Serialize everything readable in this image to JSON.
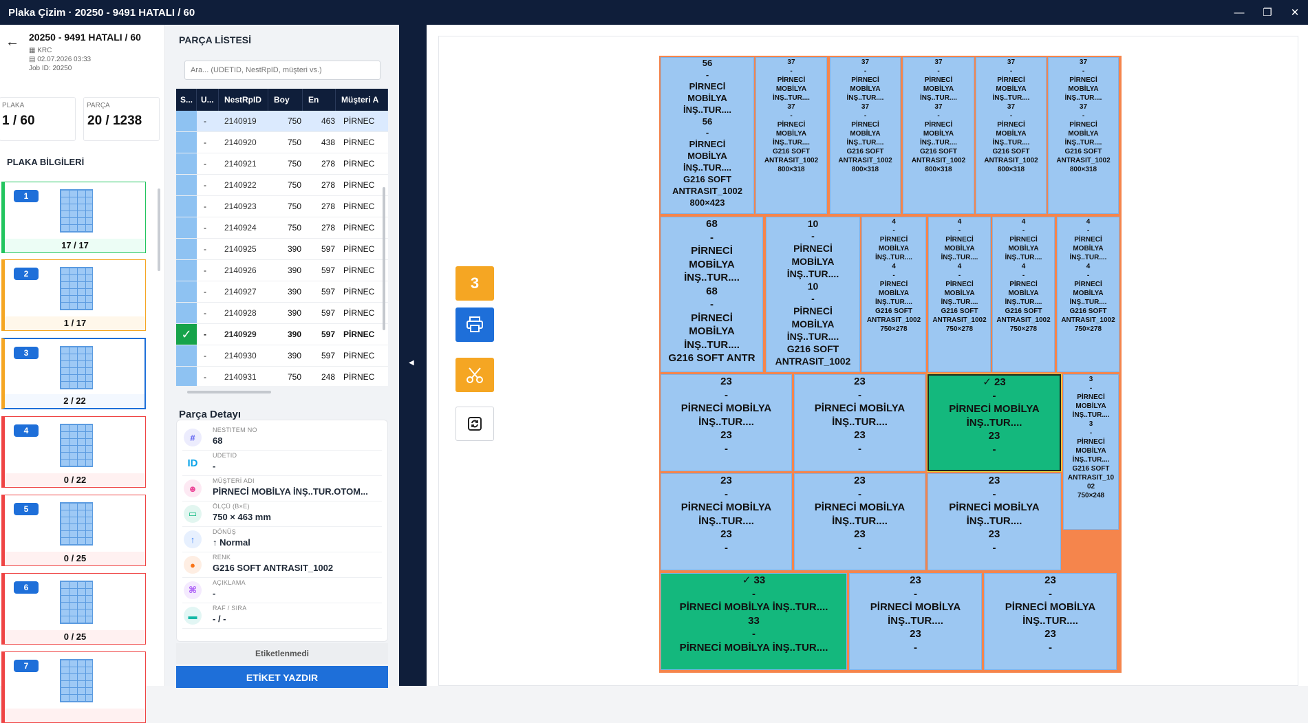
{
  "window": {
    "title": "Plaka Çizim · 20250 - 9491 HATALI / 60",
    "min_icon": "minimize-icon",
    "max_icon": "maximize-icon",
    "close_icon": "close-icon"
  },
  "job": {
    "title": "20250 - 9491 HATALI / 60",
    "customer": "KRC",
    "date": "02.07.2026 03:33",
    "job_id": "Job ID: 20250"
  },
  "stats": {
    "plaka_label": "PLAKA",
    "plaka_value": "1 / 60",
    "parca_label": "PARÇA",
    "parca_value": "20 / 1238"
  },
  "plaka_section_title": "PLAKA BİLGİLERİ",
  "plates": [
    {
      "num": "1",
      "count": "17 / 17",
      "status_color": "#22c55e",
      "bg": "#ecfdf5"
    },
    {
      "num": "2",
      "count": "1 / 17",
      "status_color": "#f5a623",
      "bg": "#fff7ea"
    },
    {
      "num": "3",
      "count": "2 / 22",
      "status_color": "#1e6fd9",
      "bg": "#f3f8ff"
    },
    {
      "num": "4",
      "count": "0 / 22",
      "status_color": "#ef4444",
      "bg": "#fff1f1"
    },
    {
      "num": "5",
      "count": "0 / 25",
      "status_color": "#ef4444",
      "bg": "#fff1f1"
    },
    {
      "num": "6",
      "count": "0 / 25",
      "status_color": "#ef4444",
      "bg": "#fff1f1"
    },
    {
      "num": "7",
      "count": "",
      "status_color": "#ef4444",
      "bg": "#fff1f1"
    }
  ],
  "parts_list": {
    "title": "PARÇA LİSTESİ",
    "search_placeholder": "Ara... (UDETID, NestRpID, müşteri vs.)",
    "columns": [
      "S...",
      "U...",
      "NestRpID",
      "Boy",
      "En",
      "Müşteri A"
    ],
    "rows": [
      {
        "s": "",
        "u": "-",
        "id": "2140919",
        "boy": "750",
        "en": "463",
        "m": "PİRNEC",
        "sel": true,
        "done": false
      },
      {
        "s": "",
        "u": "-",
        "id": "2140920",
        "boy": "750",
        "en": "438",
        "m": "PİRNEC",
        "sel": false,
        "done": false
      },
      {
        "s": "",
        "u": "-",
        "id": "2140921",
        "boy": "750",
        "en": "278",
        "m": "PİRNEC",
        "sel": false,
        "done": false
      },
      {
        "s": "",
        "u": "-",
        "id": "2140922",
        "boy": "750",
        "en": "278",
        "m": "PİRNEC",
        "sel": false,
        "done": false
      },
      {
        "s": "",
        "u": "-",
        "id": "2140923",
        "boy": "750",
        "en": "278",
        "m": "PİRNEC",
        "sel": false,
        "done": false
      },
      {
        "s": "",
        "u": "-",
        "id": "2140924",
        "boy": "750",
        "en": "278",
        "m": "PİRNEC",
        "sel": false,
        "done": false
      },
      {
        "s": "",
        "u": "-",
        "id": "2140925",
        "boy": "390",
        "en": "597",
        "m": "PİRNEC",
        "sel": false,
        "done": false
      },
      {
        "s": "",
        "u": "-",
        "id": "2140926",
        "boy": "390",
        "en": "597",
        "m": "PİRNEC",
        "sel": false,
        "done": false
      },
      {
        "s": "",
        "u": "-",
        "id": "2140927",
        "boy": "390",
        "en": "597",
        "m": "PİRNEC",
        "sel": false,
        "done": false
      },
      {
        "s": "",
        "u": "-",
        "id": "2140928",
        "boy": "390",
        "en": "597",
        "m": "PİRNEC",
        "sel": false,
        "done": false
      },
      {
        "s": "✓",
        "u": "-",
        "id": "2140929",
        "boy": "390",
        "en": "597",
        "m": "PİRNEC",
        "sel": false,
        "done": true
      },
      {
        "s": "",
        "u": "-",
        "id": "2140930",
        "boy": "390",
        "en": "597",
        "m": "PİRNEC",
        "sel": false,
        "done": false
      },
      {
        "s": "",
        "u": "-",
        "id": "2140931",
        "boy": "750",
        "en": "248",
        "m": "PİRNEC",
        "sel": false,
        "done": false
      }
    ]
  },
  "detail": {
    "title": "Parça Detayı",
    "fields": [
      {
        "label": "NESTITEM NO",
        "value": "68",
        "icon": "#",
        "icon_name": "hash-icon",
        "color": "#6366f1"
      },
      {
        "label": "UDETID",
        "value": "-",
        "icon": "ID",
        "icon_name": "id-icon",
        "color": "#0ea5e9"
      },
      {
        "label": "MÜŞTERİ ADI",
        "value": "PİRNECİ MOBİLYA İNŞ..TUR.OTOM...",
        "icon": "☻",
        "icon_name": "user-icon",
        "color": "#ec4899"
      },
      {
        "label": "ÖLÇÜ (B×E)",
        "value": "750 × 463 mm",
        "icon": "▭",
        "icon_name": "ruler-icon",
        "color": "#10b981"
      },
      {
        "label": "DÖNÜŞ",
        "value": "↑ Normal",
        "icon": "↑",
        "icon_name": "arrow-up-icon",
        "color": "#3b82f6"
      },
      {
        "label": "RENK",
        "value": "G216 SOFT ANTRASIT_1002",
        "icon": "●",
        "icon_name": "color-icon",
        "color": "#f97316"
      },
      {
        "label": "AÇIKLAMA",
        "value": "-",
        "icon": "⌘",
        "icon_name": "note-icon",
        "color": "#a855f7"
      },
      {
        "label": "RAF / SIRA",
        "value": "-  /  -",
        "icon": "▬",
        "icon_name": "shelf-icon",
        "color": "#14b8a6"
      }
    ],
    "status": "Etiketlenmedi",
    "print_label": "ETİKET YAZDIR"
  },
  "tools": {
    "count": "3",
    "count_color": "#f5a623",
    "print_icon": "printer-icon",
    "cut_icon": "scissors-icon",
    "refresh_icon": "refresh-icon"
  },
  "plate_parts": [
    {
      "txt": "56\n-\nPİRNECİ\nMOBİLYA\nİNŞ..TUR....\n56\n-\nPİRNECİ\nMOBİLYA\nİNŞ..TUR....\nG216 SOFT\nANTRASIT_1002\n800×423",
      "done": false,
      "hl": false
    },
    {
      "txt": "37\n-\nPİRNECİ\nMOBİLYA\nİNŞ..TUR....\n37\n-\nPİRNECİ\nMOBİLYA\nİNŞ..TUR....\nG216 SOFT\nANTRASIT_1002\n800×318",
      "done": false,
      "hl": false
    },
    {
      "txt": "37\n-\nPİRNECİ\nMOBİLYA\nİNŞ..TUR....\n37\n-\nPİRNECİ\nMOBİLYA\nİNŞ..TUR....\nG216 SOFT\nANTRASIT_1002\n800×318",
      "done": false,
      "hl": false
    },
    {
      "txt": "37\n-\nPİRNECİ\nMOBİLYA\nİNŞ..TUR....\n37\n-\nPİRNECİ\nMOBİLYA\nİNŞ..TUR....\nG216 SOFT\nANTRASIT_1002\n800×318",
      "done": false,
      "hl": false
    },
    {
      "txt": "37\n-\nPİRNECİ\nMOBİLYA\nİNŞ..TUR....\n37\n-\nPİRNECİ\nMOBİLYA\nİNŞ..TUR....\nG216 SOFT\nANTRASIT_1002\n800×318",
      "done": false,
      "hl": false
    },
    {
      "txt": "37\n-\nPİRNECİ\nMOBİLYA\nİNŞ..TUR....\n37\n-\nPİRNECİ\nMOBİLYA\nİNŞ..TUR....\nG216 SOFT\nANTRASIT_1002\n800×318",
      "done": false,
      "hl": false
    },
    {
      "txt": "68\n-\nPİRNECİ\nMOBİLYA\nİNŞ..TUR....\n68\n-\nPİRNECİ\nMOBİLYA\nİNŞ..TUR....\nG216 SOFT ANTR",
      "done": false,
      "hl": false
    },
    {
      "txt": "10\n-\nPİRNECİ\nMOBİLYA\nİNŞ..TUR....\n10\n-\nPİRNECİ\nMOBİLYA\nİNŞ..TUR....\nG216 SOFT\nANTRASIT_1002",
      "done": false,
      "hl": false
    },
    {
      "txt": "4\n-\nPİRNECİ\nMOBİLYA\nİNŞ..TUR....\n4\n-\nPİRNECİ\nMOBİLYA\nİNŞ..TUR....\nG216 SOFT\nANTRASIT_1002\n750×278",
      "done": false,
      "hl": false
    },
    {
      "txt": "4\n-\nPİRNECİ\nMOBİLYA\nİNŞ..TUR....\n4\n-\nPİRNECİ\nMOBİLYA\nİNŞ..TUR....\nG216 SOFT\nANTRASIT_1002\n750×278",
      "done": false,
      "hl": false
    },
    {
      "txt": "4\n-\nPİRNECİ\nMOBİLYA\nİNŞ..TUR....\n4\n-\nPİRNECİ\nMOBİLYA\nİNŞ..TUR....\nG216 SOFT\nANTRASIT_1002\n750×278",
      "done": false,
      "hl": false
    },
    {
      "txt": "4\n-\nPİRNECİ\nMOBİLYA\nİNŞ..TUR....\n4\n-\nPİRNECİ\nMOBİLYA\nİNŞ..TUR....\nG216 SOFT\nANTRASIT_1002\n750×278",
      "done": false,
      "hl": false
    },
    {
      "txt": "23\n-\nPİRNECİ MOBİLYA\nİNŞ..TUR....\n23\n-",
      "done": false,
      "hl": false
    },
    {
      "txt": "23\n-\nPİRNECİ MOBİLYA\nİNŞ..TUR....\n23\n-",
      "done": false,
      "hl": false
    },
    {
      "txt": "✓ 23\n-\nPİRNECİ MOBİLYA\nİNŞ..TUR....\n23\n-",
      "done": true,
      "hl": true
    },
    {
      "txt": "3\n-\nPİRNECİ\nMOBİLYA\nİNŞ..TUR....\n3\n-\nPİRNECİ\nMOBİLYA\nİNŞ..TUR....\nG216 SOFT\nANTRASIT_10\n02\n750×248",
      "done": false,
      "hl": false
    },
    {
      "txt": "23\n-\nPİRNECİ MOBİLYA\nİNŞ..TUR....\n23\n-",
      "done": false,
      "hl": false
    },
    {
      "txt": "23\n-\nPİRNECİ MOBİLYA\nİNŞ..TUR....\n23\n-",
      "done": false,
      "hl": false
    },
    {
      "txt": "23\n-\nPİRNECİ MOBİLYA\nİNŞ..TUR....\n23\n-",
      "done": false,
      "hl": false
    },
    {
      "txt": "✓ 33\n-\nPİRNECİ MOBİLYA İNŞ..TUR....\n33\n-\nPİRNECİ MOBİLYA İNŞ..TUR....",
      "done": true,
      "hl": false
    },
    {
      "txt": "23\n-\nPİRNECİ MOBİLYA\nİNŞ..TUR....\n23\n-",
      "done": false,
      "hl": false
    },
    {
      "txt": "23\n-\nPİRNECİ MOBİLYA\nİNŞ..TUR....\n23\n-",
      "done": false,
      "hl": false
    }
  ]
}
